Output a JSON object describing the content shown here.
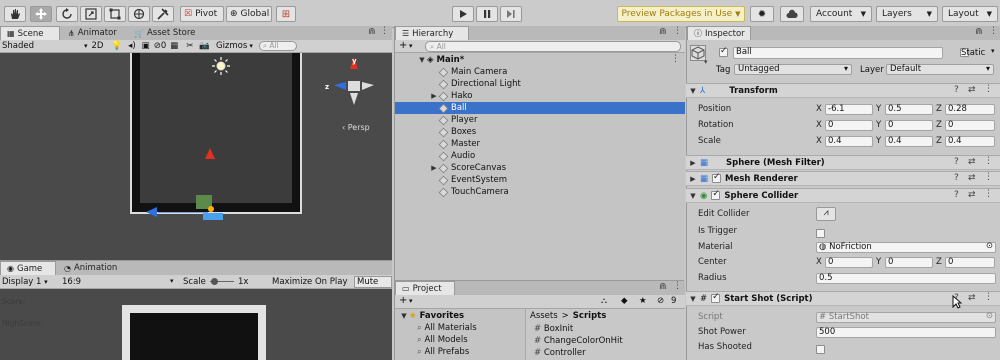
{
  "toolbar": {
    "tool_icons": [
      "hand-icon",
      "move-icon",
      "rotate-icon",
      "scale-icon",
      "rect-icon",
      "transform-icon",
      "custom-tool-icon"
    ],
    "pivot_label": "Pivot",
    "global_label": "Global",
    "preview_label": "Preview Packages in Use",
    "account_label": "Account",
    "layers_label": "Layers",
    "layout_label": "Layout"
  },
  "scene": {
    "tabs": [
      "Scene",
      "Animator",
      "Asset Store"
    ],
    "shading": "Shaded",
    "mode_2d": "2D",
    "hidden_count": "0",
    "gizmos": "Gizmos",
    "search_placeholder": "All",
    "persp_label": "‹ Persp"
  },
  "game": {
    "tabs": [
      "Game",
      "Animation"
    ],
    "display": "Display 1",
    "aspect": "16:9",
    "scale_label": "Scale",
    "scale_value": "1x",
    "maximize": "Maximize On Play",
    "mute": "Mute Au",
    "score_text": "Score:",
    "highscore_text": "HighScore:"
  },
  "hierarchy": {
    "tab": "Hierarchy",
    "search_placeholder": "All",
    "root": "Main*",
    "items": [
      {
        "label": "Main Camera",
        "expandable": false,
        "selected": false
      },
      {
        "label": "Directional Light",
        "expandable": false,
        "selected": false
      },
      {
        "label": "Hako",
        "expandable": true,
        "selected": false
      },
      {
        "label": "Ball",
        "expandable": false,
        "selected": true
      },
      {
        "label": "Player",
        "expandable": false,
        "selected": false
      },
      {
        "label": "Boxes",
        "expandable": false,
        "selected": false
      },
      {
        "label": "Master",
        "expandable": false,
        "selected": false
      },
      {
        "label": "Audio",
        "expandable": false,
        "selected": false
      },
      {
        "label": "ScoreCanvas",
        "expandable": true,
        "selected": false
      },
      {
        "label": "EventSystem",
        "expandable": false,
        "selected": false
      },
      {
        "label": "TouchCamera",
        "expandable": false,
        "selected": false
      }
    ]
  },
  "project": {
    "tab": "Project",
    "hidden_count": "9",
    "favorites_label": "Favorites",
    "favorites": [
      "All Materials",
      "All Models",
      "All Prefabs"
    ],
    "breadcrumb_root": "Assets",
    "breadcrumb_sep": ">",
    "breadcrumb_current": "Scripts",
    "files": [
      "BoxInit",
      "ChangeColorOnHit",
      "Controller"
    ]
  },
  "inspector": {
    "tab": "Inspector",
    "object_name": "Ball",
    "static_label": "Static",
    "tag_label": "Tag",
    "tag_value": "Untagged",
    "layer_label": "Layer",
    "layer_value": "Default",
    "transform": {
      "title": "Transform",
      "position_label": "Position",
      "rotation_label": "Rotation",
      "scale_label": "Scale",
      "axis_x": "X",
      "axis_y": "Y",
      "axis_z": "Z",
      "position": [
        "-6.1",
        "0.5",
        "0.28"
      ],
      "rotation": [
        "0",
        "0",
        "0"
      ],
      "scale": [
        "0.4",
        "0.4",
        "0.4"
      ]
    },
    "mesh_filter_title": "Sphere (Mesh Filter)",
    "mesh_renderer_title": "Mesh Renderer",
    "sphere_collider": {
      "title": "Sphere Collider",
      "edit_collider": "Edit Collider",
      "is_trigger": "Is Trigger",
      "material_label": "Material",
      "material_value": "NoFriction",
      "center_label": "Center",
      "center": [
        "0",
        "0",
        "0"
      ],
      "radius_label": "Radius",
      "radius": "0.5"
    },
    "start_shot": {
      "title": "Start Shot (Script)",
      "script_label": "Script",
      "script_value": "StartShot",
      "shot_power_label": "Shot Power",
      "shot_power": "500",
      "has_shooted_label": "Has Shooted"
    }
  },
  "colors": {
    "selection": "#3a72c9",
    "preview_bg": "#f6f0c8",
    "scene_bg": "#4a4a4a"
  }
}
